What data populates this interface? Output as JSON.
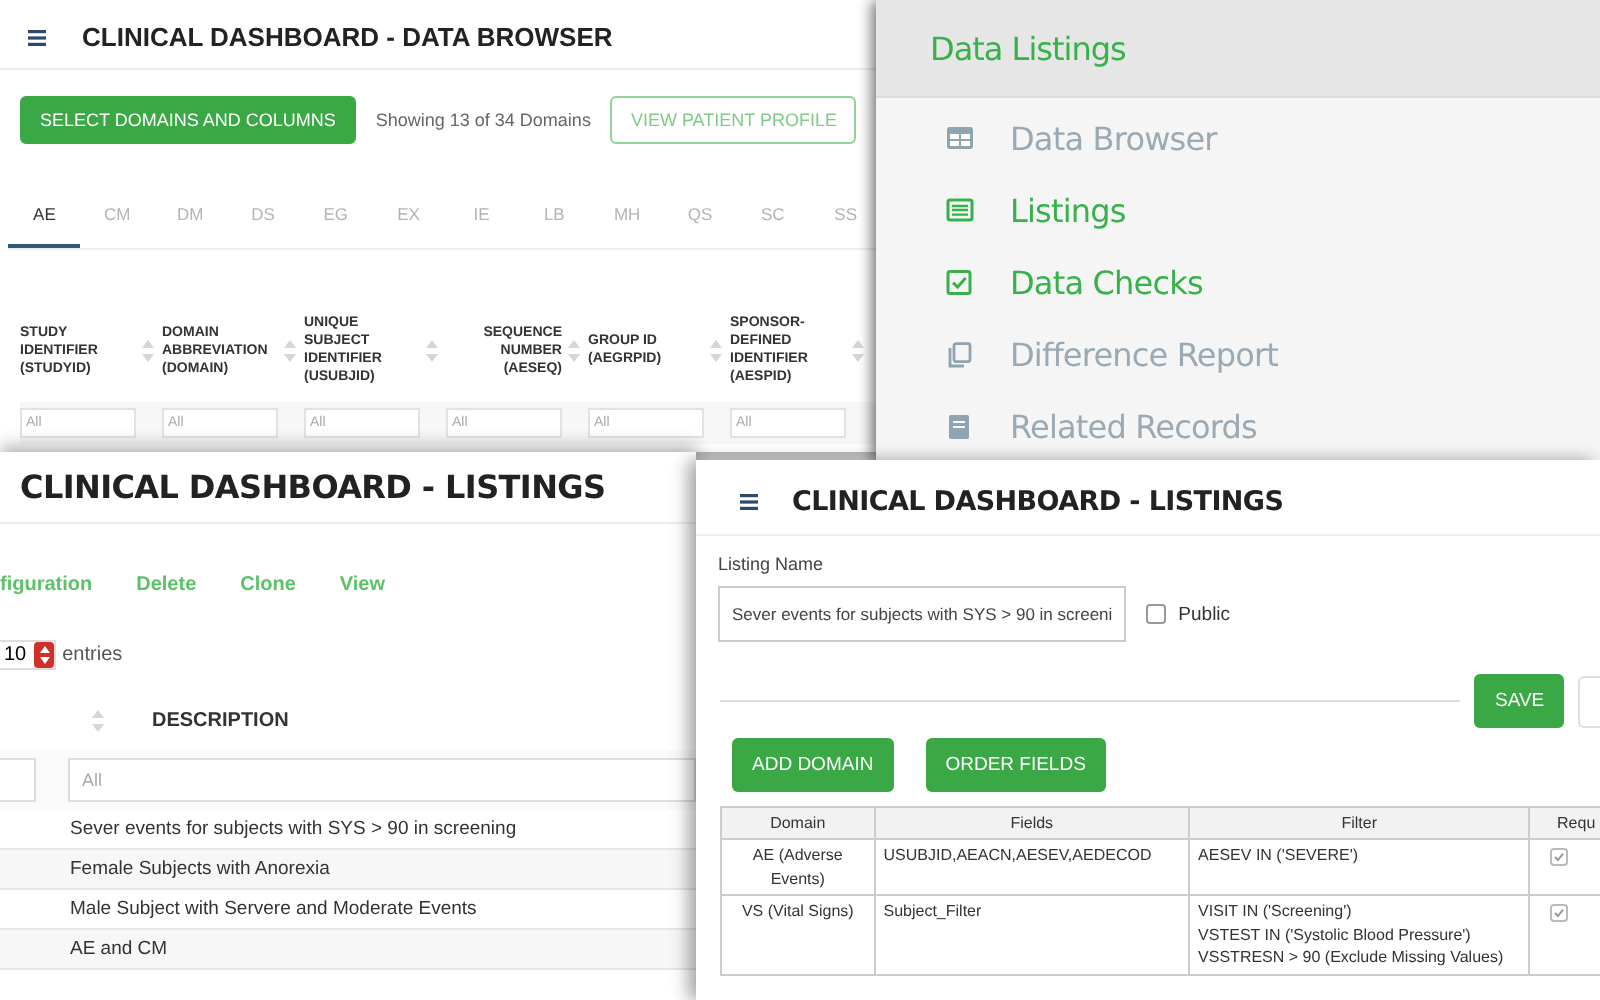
{
  "data_browser": {
    "title": "CLINICAL DASHBOARD - DATA BROWSER",
    "select_button": "SELECT DOMAINS AND COLUMNS",
    "count_text": "Showing 13 of 34 Domains",
    "profile_button": "VIEW PATIENT PROFILE",
    "tabs": [
      {
        "label": "AE",
        "selected": true
      },
      {
        "label": "CM",
        "selected": false
      },
      {
        "label": "DM",
        "selected": false
      },
      {
        "label": "DS",
        "selected": false
      },
      {
        "label": "EG",
        "selected": false
      },
      {
        "label": "EX",
        "selected": false
      },
      {
        "label": "IE",
        "selected": false
      },
      {
        "label": "LB",
        "selected": false
      },
      {
        "label": "MH",
        "selected": false
      },
      {
        "label": "QS",
        "selected": false
      },
      {
        "label": "SC",
        "selected": false
      },
      {
        "label": "SS",
        "selected": false
      }
    ],
    "columns": [
      "STUDY IDENTIFIER (STUDYID)",
      "DOMAIN ABBREVIATION (DOMAIN)",
      "UNIQUE SUBJECT IDENTIFIER (USUBJID)",
      "SEQUENCE NUMBER (AESEQ)",
      "GROUP ID (AEGRPID)",
      "SPONSOR-DEFINED IDENTIFIER (AESPID)"
    ],
    "filters": [
      {
        "placeholder": "All"
      },
      {
        "placeholder": "All"
      },
      {
        "placeholder": "All"
      },
      {
        "placeholder": "All"
      },
      {
        "placeholder": "All"
      },
      {
        "placeholder": "All"
      }
    ]
  },
  "sidebar": {
    "header": "Data Listings",
    "items": [
      {
        "label": "Data Browser",
        "selected": false
      },
      {
        "label": "Listings",
        "selected": true
      },
      {
        "label": "Data Checks",
        "selected": true
      },
      {
        "label": "Difference Report",
        "selected": false
      },
      {
        "label": "Related Records",
        "selected": false
      }
    ]
  },
  "listings": {
    "title": "CLINICAL DASHBOARD - LISTINGS",
    "actions": [
      "figuration",
      "Delete",
      "Clone",
      "View"
    ],
    "page_size": "10",
    "entries_label": "entries",
    "column": "DESCRIPTION",
    "filter_placeholder": "All",
    "rows": [
      "Sever events for subjects with SYS > 90 in screening",
      "Female Subjects with Anorexia",
      "Male Subject with Servere and Moderate Events",
      "AE and CM"
    ]
  },
  "listing_editor": {
    "title": "CLINICAL DASHBOARD - LISTINGS",
    "name_label": "Listing Name",
    "name_value": "Sever events for subjects with SYS > 90 in screeni",
    "public": {
      "label": "Public",
      "checked": false
    },
    "save_button": "SAVE",
    "add_button": "ADD DOMAIN",
    "order_button": "ORDER FIELDS",
    "table": {
      "columns": [
        "Domain",
        "Fields",
        "Filter",
        "Requ"
      ],
      "rows": [
        {
          "domain": "AE (Adverse Events)",
          "fields": "USUBJID,AEACN,AESEV,AEDECOD",
          "filter": [
            "AESEV IN ('SEVERE')"
          ],
          "required": true
        },
        {
          "domain": "VS (Vital Signs)",
          "fields": "Subject_Filter",
          "filter": [
            "VISIT IN ('Screening')",
            "VSTEST IN ('Systolic Blood Pressure')",
            "VSSTRESN > 90 (Exclude Missing Values)"
          ],
          "required": true
        }
      ]
    }
  }
}
